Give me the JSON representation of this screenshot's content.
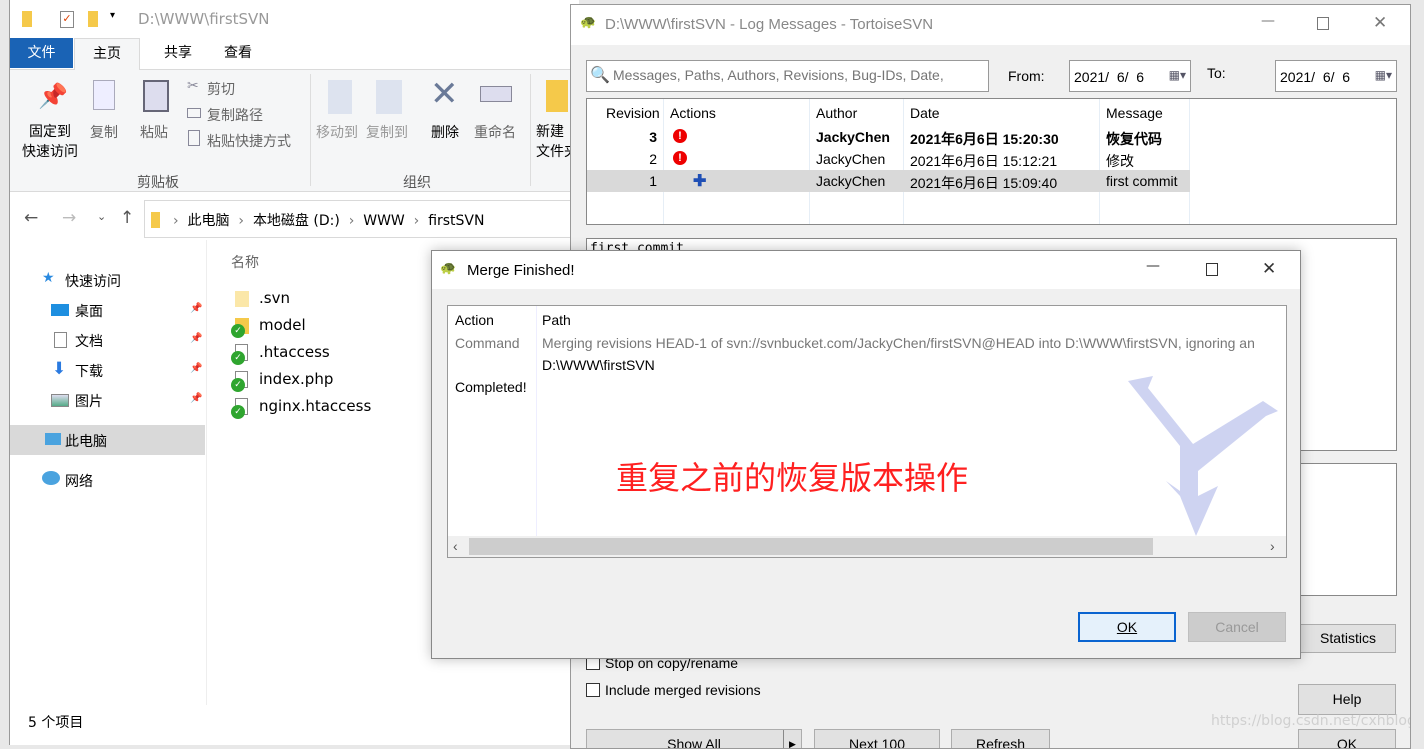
{
  "explorer": {
    "title": "D:\\WWW\\firstSVN",
    "tabs": [
      "文件",
      "主页",
      "共享",
      "查看"
    ],
    "ribbon": {
      "pin": "固定到\n快速访问",
      "pin1": "固定到",
      "pin2": "快速访问",
      "copy": "复制",
      "paste": "粘贴",
      "cut": "剪切",
      "copy_path": "复制路径",
      "paste_shortcut": "粘贴快捷方式",
      "clipboard_group": "剪贴板",
      "move_to": "移动到",
      "copy_to": "复制到",
      "delete": "删除",
      "rename": "重命名",
      "new1": "新建",
      "new2": "文件夹",
      "organize_group": "组织"
    },
    "breadcrumb": [
      "此电脑",
      "本地磁盘 (D:)",
      "WWW",
      "firstSVN"
    ],
    "nav": {
      "quick_access": "快速访问",
      "items": [
        "桌面",
        "文档",
        "下载",
        "图片"
      ],
      "this_pc": "此电脑",
      "network": "网络"
    },
    "column_name": "名称",
    "files": [
      {
        "name": ".svn",
        "type": "folder",
        "status": "none"
      },
      {
        "name": "model",
        "type": "folder",
        "status": "normal"
      },
      {
        "name": ".htaccess",
        "type": "file",
        "status": "normal"
      },
      {
        "name": "index.php",
        "type": "file",
        "status": "normal"
      },
      {
        "name": "nginx.htaccess",
        "type": "file",
        "status": "normal"
      }
    ],
    "status": "5 个项目"
  },
  "log": {
    "title": "D:\\WWW\\firstSVN - Log Messages - TortoiseSVN",
    "search_placeholder": "Messages, Paths, Authors, Revisions, Bug-IDs, Date,",
    "from_label": "From:",
    "from_date": "2021/  6/  6",
    "to_label": "To:",
    "to_date": "2021/  6/  6",
    "columns": [
      "Revision",
      "Actions",
      "Author",
      "Date",
      "Message"
    ],
    "rows": [
      {
        "revision": "3",
        "action": "modified",
        "author": "JackyChen",
        "date": "2021年6月6日 15:20:30",
        "message": "恢复代码",
        "bold": true
      },
      {
        "revision": "2",
        "action": "modified",
        "author": "JackyChen",
        "date": "2021年6月6日 15:12:21",
        "message": "修改",
        "bold": false
      },
      {
        "revision": "1",
        "action": "added",
        "author": "JackyChen",
        "date": "2021年6月6日 15:09:40",
        "message": "first commit",
        "bold": false,
        "selected": true
      }
    ],
    "message_text": "first commit",
    "stop_on_copy": "Stop on copy/rename",
    "include_merged": "Include merged revisions",
    "statistics": "Statistics",
    "help": "Help",
    "show_all": "Show All",
    "next_100": "Next 100",
    "refresh": "Refresh",
    "ok": "OK"
  },
  "merge": {
    "title": "Merge Finished!",
    "columns": [
      "Action",
      "Path"
    ],
    "rows": [
      {
        "action": "Command",
        "path": "Merging revisions HEAD-1 of svn://svnbucket.com/JackyChen/firstSVN@HEAD into D:\\WWW\\firstSVN, ignoring an"
      },
      {
        "action": "",
        "path": "D:\\WWW\\firstSVN"
      },
      {
        "action": "Completed!",
        "path": ""
      }
    ],
    "annotation": "重复之前的恢复版本操作",
    "ok": "OK",
    "cancel": "Cancel",
    "annotation_color": "#ff2020"
  },
  "watermark": "https://blog.csdn.net/cxhblog"
}
